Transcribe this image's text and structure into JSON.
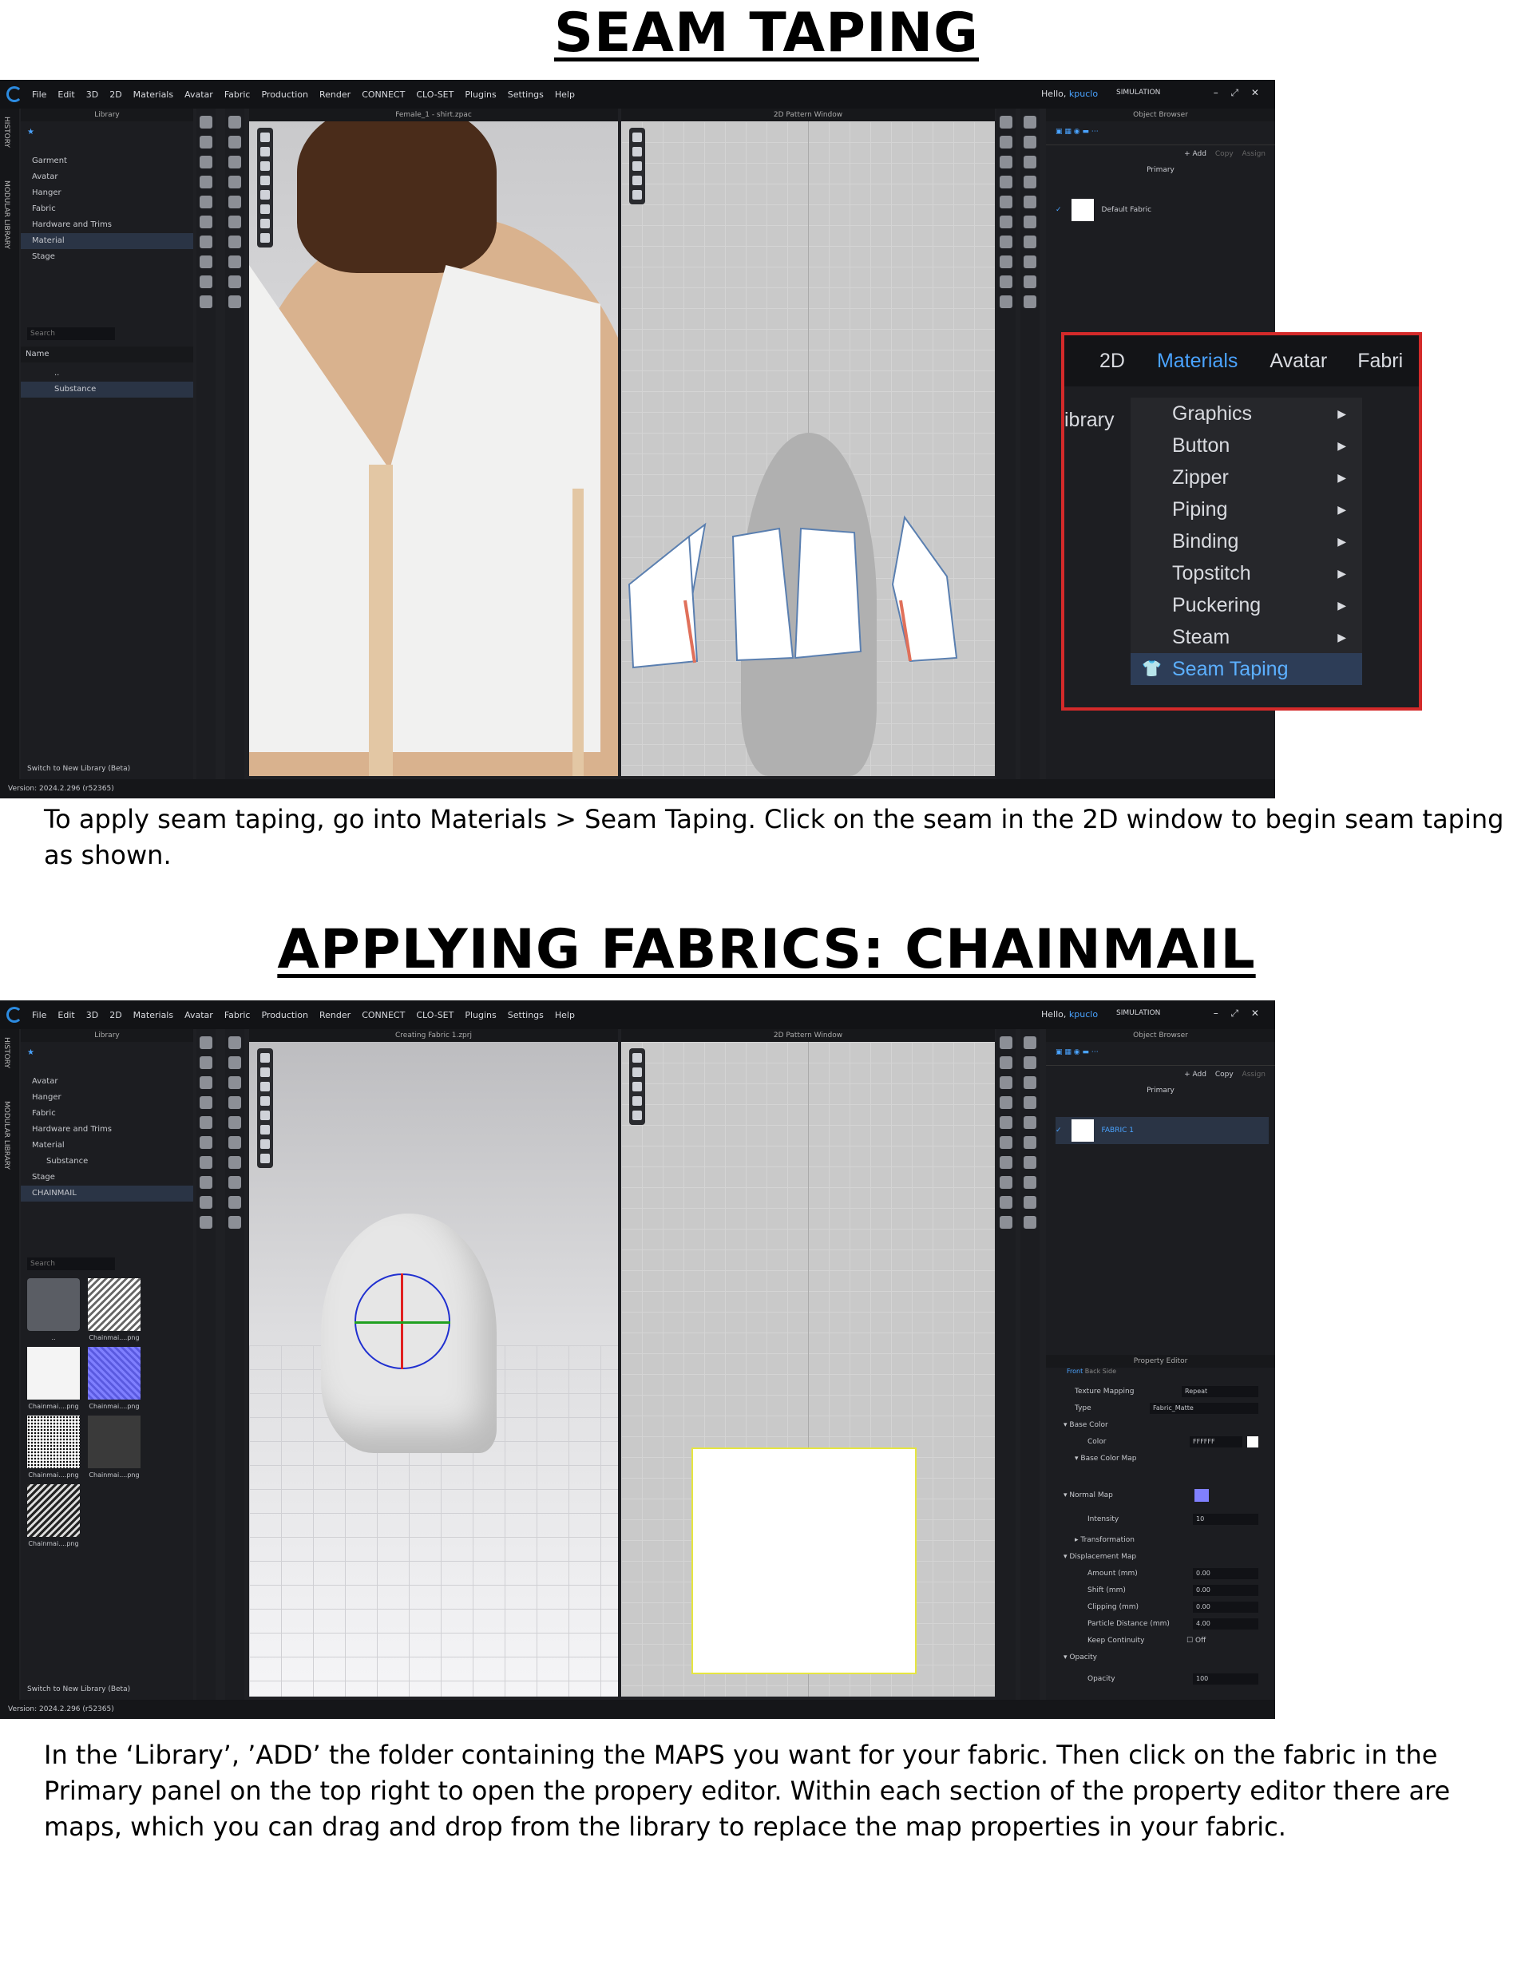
{
  "section1": {
    "heading": "SEAM TAPING",
    "caption": "To apply seam taping, go into Materials > Seam Taping. Click on the seam in the 2D window to begin seam taping as shown.",
    "screenshot": {
      "menu": [
        "File",
        "Edit",
        "3D",
        "2D",
        "Materials",
        "Avatar",
        "Fabric",
        "Production",
        "Render",
        "CONNECT",
        "CLO-SET",
        "Plugins",
        "Settings",
        "Help"
      ],
      "hello": "Hello,",
      "user": "kpuclo",
      "simulation": "SIMULATION",
      "side_tabs": [
        "HISTORY",
        "MODULAR LIBRARY"
      ],
      "library_title": "Library",
      "tree": [
        "Garment",
        "Avatar",
        "Hanger",
        "Fabric",
        "Hardware and Trims",
        "Material",
        "Stage"
      ],
      "search_placeholder": "Search",
      "name_header": "Name",
      "files": [
        "..",
        "Substance"
      ],
      "switch_library": "Switch to New Library (Beta)",
      "viewport_3d_title": "Female_1 - shirt.zpac",
      "viewport_2d_title": "2D Pattern Window",
      "object_browser_title": "Object Browser",
      "add_label": "+ Add",
      "copy_label": "Copy",
      "assign_label": "Assign",
      "primary_label": "Primary",
      "fabric_name": "Default Fabric",
      "version": "Version: 2024.2.296 (r52365)"
    },
    "zoom_menu": {
      "top_items": [
        "2D",
        "Materials",
        "Avatar",
        "Fabri"
      ],
      "side_label": "ibrary",
      "items": [
        "Graphics",
        "Button",
        "Zipper",
        "Piping",
        "Binding",
        "Topstitch",
        "Puckering",
        "Steam",
        "Seam Taping"
      ],
      "highlight": "Seam Taping"
    }
  },
  "section2": {
    "heading": "APPLYING FABRICS: CHAINMAIL",
    "caption": "In the ‘Library’, ’ADD’ the folder containing the MAPS you want for your fabric. Then click on the fabric in the Primary panel on the top right to open the propery editor. Within each section of the property editor there are maps, which you can drag and drop from the library to replace the map properties in your fabric.",
    "screenshot": {
      "library_title": "Library",
      "tree": [
        "Avatar",
        "Hanger",
        "Fabric",
        "Hardware and Trims",
        "Material",
        "Substance",
        "Stage",
        "CHAINMAIL"
      ],
      "search_placeholder": "Search",
      "thumbnails": [
        "..",
        "Chainmai....png",
        "Chainmai....png",
        "Chainmai....png",
        "Chainmai....png",
        "Chainmai....png",
        "Chainmai....png"
      ],
      "switch_library": "Switch to New Library (Beta)",
      "viewport_3d_title": "Creating Fabric 1.zprj",
      "viewport_2d_title": "2D Pattern Window",
      "object_browser_title": "Object Browser",
      "add_label": "+ Add",
      "copy_label": "Copy",
      "assign_label": "Assign",
      "primary_label": "Primary",
      "fabric_name": "FABRIC 1",
      "property_editor_title": "Property Editor",
      "pe_tabs": [
        "Front",
        "Back",
        "Side"
      ],
      "properties": [
        {
          "label": "Texture Mapping",
          "value": "Repeat"
        },
        {
          "label": "Type",
          "value": "Fabric_Matte"
        },
        {
          "label": "Base Color",
          "value": ""
        },
        {
          "label": "Color",
          "value": "FFFFFF"
        },
        {
          "label": "Base Color Map",
          "value": ""
        },
        {
          "label": "Normal Map",
          "value": ""
        },
        {
          "label": "Intensity",
          "value": "10"
        },
        {
          "label": "Transformation",
          "value": ""
        },
        {
          "label": "Displacement Map",
          "value": ""
        },
        {
          "label": "Amount (mm)",
          "value": "0.00"
        },
        {
          "label": "Shift (mm)",
          "value": "0.00"
        },
        {
          "label": "Clipping (mm)",
          "value": "0.00"
        },
        {
          "label": "Particle Distance (mm)",
          "value": "4.00"
        },
        {
          "label": "Keep Continuity",
          "value": "Off"
        },
        {
          "label": "Opacity",
          "value": ""
        },
        {
          "label": "Opacity",
          "value": "100"
        }
      ],
      "version": "Version: 2024.2.296 (r52365)"
    }
  },
  "colors": {
    "accent": "#4aa3ff",
    "highlight_border": "#d42a2a",
    "ui_bg": "#1f2024"
  }
}
